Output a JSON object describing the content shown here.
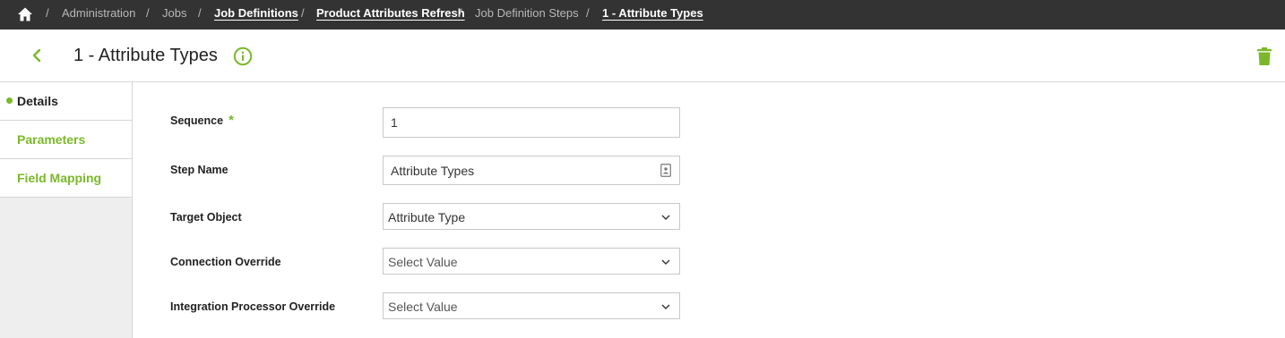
{
  "breadcrumb": {
    "items": [
      {
        "label": "Administration"
      },
      {
        "label": "Jobs"
      },
      {
        "label": "Job Definitions"
      },
      {
        "label": "Product Attributes Refresh"
      },
      {
        "label": "Job Definition Steps"
      },
      {
        "label": "1 - Attribute Types"
      }
    ],
    "separator": "/"
  },
  "header": {
    "title": "1 - Attribute Types"
  },
  "sidebar": {
    "items": [
      {
        "label": "Details",
        "active": true
      },
      {
        "label": "Parameters",
        "active": false
      },
      {
        "label": "Field Mapping",
        "active": false
      }
    ]
  },
  "form": {
    "sequence": {
      "label": "Sequence",
      "required_mark": "*",
      "value": "1"
    },
    "step_name": {
      "label": "Step Name",
      "value": "Attribute Types"
    },
    "target_object": {
      "label": "Target Object",
      "value": "Attribute Type"
    },
    "connection_override": {
      "label": "Connection Override",
      "placeholder": "Select Value"
    },
    "integration_processor_override": {
      "label": "Integration Processor Override",
      "placeholder": "Select Value"
    }
  },
  "icons": {
    "home": "home-icon",
    "back": "chevron-left-icon",
    "info": "info-icon",
    "delete": "trash-icon",
    "field_lookup": "contact-card-icon",
    "dropdown": "chevron-down-icon"
  },
  "colors": {
    "topbar": "#333333",
    "accent": "#7ab829",
    "sidebar_bg": "#eeeeee"
  }
}
